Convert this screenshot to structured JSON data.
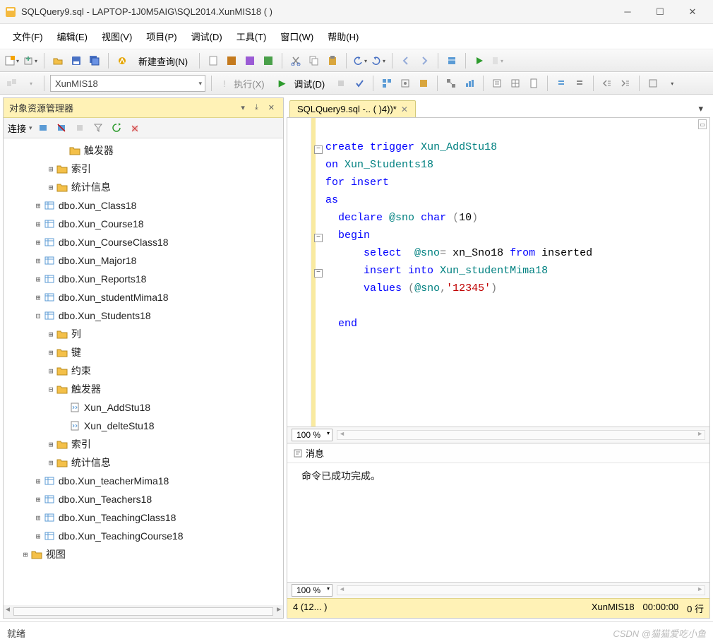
{
  "titlebar": {
    "title": "SQLQuery9.sql - LAPTOP-1J0M5AIG\\SQL2014.XunMIS18 (                                     )"
  },
  "menu": [
    "文件(F)",
    "编辑(E)",
    "视图(V)",
    "项目(P)",
    "调试(D)",
    "工具(T)",
    "窗口(W)",
    "帮助(H)"
  ],
  "toolbar1": {
    "new_query": "新建查询(N)"
  },
  "toolbar2": {
    "db_combo": "XunMIS18",
    "execute": "执行(X)",
    "debug": "调试(D)"
  },
  "obj_explorer": {
    "title": "对象资源管理器",
    "connect": "连接",
    "tree": [
      {
        "d": 4,
        "e": "",
        "i": "folder",
        "t": "触发器"
      },
      {
        "d": 3,
        "e": "+",
        "i": "folder",
        "t": "索引"
      },
      {
        "d": 3,
        "e": "+",
        "i": "folder",
        "t": "统计信息"
      },
      {
        "d": 2,
        "e": "+",
        "i": "table",
        "t": "dbo.Xun_Class18"
      },
      {
        "d": 2,
        "e": "+",
        "i": "table",
        "t": "dbo.Xun_Course18"
      },
      {
        "d": 2,
        "e": "+",
        "i": "table",
        "t": "dbo.Xun_CourseClass18"
      },
      {
        "d": 2,
        "e": "+",
        "i": "table",
        "t": "dbo.Xun_Major18"
      },
      {
        "d": 2,
        "e": "+",
        "i": "table",
        "t": "dbo.Xun_Reports18"
      },
      {
        "d": 2,
        "e": "+",
        "i": "table",
        "t": "dbo.Xun_studentMima18"
      },
      {
        "d": 2,
        "e": "-",
        "i": "table",
        "t": "dbo.Xun_Students18"
      },
      {
        "d": 3,
        "e": "+",
        "i": "folder",
        "t": "列"
      },
      {
        "d": 3,
        "e": "+",
        "i": "folder",
        "t": "键"
      },
      {
        "d": 3,
        "e": "+",
        "i": "folder",
        "t": "约束"
      },
      {
        "d": 3,
        "e": "-",
        "i": "folder",
        "t": "触发器"
      },
      {
        "d": 4,
        "e": "",
        "i": "script",
        "t": "Xun_AddStu18"
      },
      {
        "d": 4,
        "e": "",
        "i": "script",
        "t": "Xun_delteStu18"
      },
      {
        "d": 3,
        "e": "+",
        "i": "folder",
        "t": "索引"
      },
      {
        "d": 3,
        "e": "+",
        "i": "folder",
        "t": "统计信息"
      },
      {
        "d": 2,
        "e": "+",
        "i": "table",
        "t": "dbo.Xun_teacherMima18"
      },
      {
        "d": 2,
        "e": "+",
        "i": "table",
        "t": "dbo.Xun_Teachers18"
      },
      {
        "d": 2,
        "e": "+",
        "i": "table",
        "t": "dbo.Xun_TeachingClass18"
      },
      {
        "d": 2,
        "e": "+",
        "i": "table",
        "t": "dbo.Xun_TeachingCourse18"
      },
      {
        "d": 1,
        "e": "+",
        "i": "folder",
        "t": "视图"
      }
    ]
  },
  "editor": {
    "tab": "SQLQuery9.sql -..                         (       )4))*",
    "zoom": "100 %",
    "code": {
      "l1a": "create",
      "l1b": "trigger",
      "l1c": "Xun_AddStu18",
      "l2a": "on",
      "l2b": "Xun_Students18",
      "l3a": "for",
      "l3b": "insert",
      "l4": "as",
      "l5a": "declare",
      "l5b": "@sno",
      "l5c": "char",
      "l5d": "(",
      "l5e": "10",
      "l5f": ")",
      "l6": "begin",
      "l7a": "select",
      "l7b": "@sno",
      "l7c": "=",
      "l7d": "xn_Sno18",
      "l7e": "from",
      "l7f": "inserted",
      "l8a": "insert",
      "l8b": "into",
      "l8c": "Xun_studentMima18",
      "l9a": "values",
      "l9b": "(",
      "l9c": "@sno",
      "l9d": ",",
      "l9e": "'12345'",
      "l9f": ")",
      "l10": "end"
    }
  },
  "messages": {
    "tab": "消息",
    "body": "命令已成功完成。",
    "zoom": "100 %"
  },
  "status": {
    "left": "4 (12...                                                          )",
    "db": "XunMIS18",
    "time": "00:00:00",
    "rows": "0 行"
  },
  "footer": {
    "ready": "就绪",
    "watermark": "CSDN @猫猫爱吃小鱼"
  }
}
